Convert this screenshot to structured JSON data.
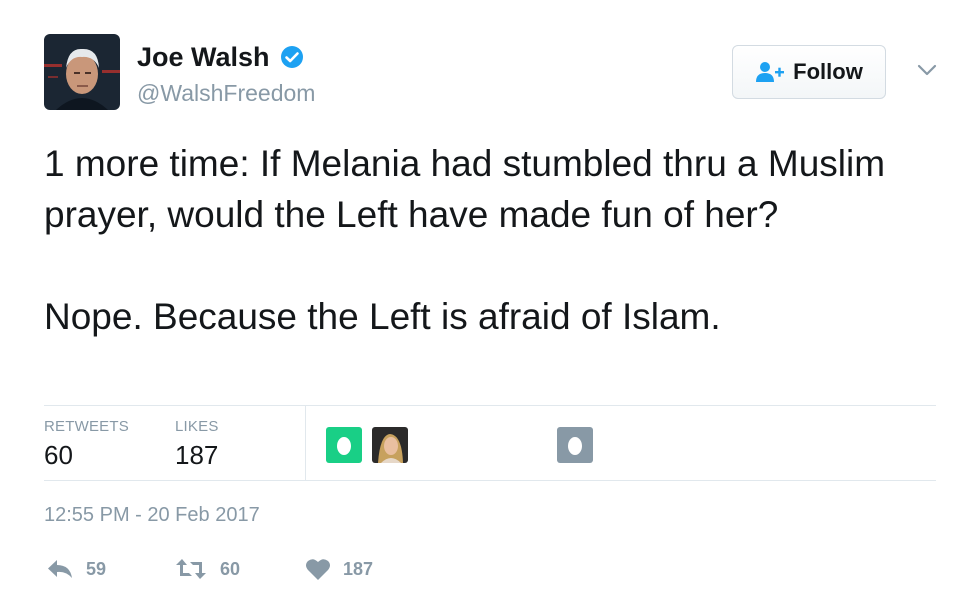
{
  "author": {
    "name": "Joe Walsh",
    "handle": "@WalshFreedom",
    "verified": true
  },
  "follow": {
    "label": "Follow",
    "icon": "add-user-icon"
  },
  "tweet": {
    "paragraphs": [
      "1 more time: If Melania had stumbled thru a Muslim prayer, would the Left have made fun of her?",
      "Nope. Because the Left is afraid of Islam."
    ]
  },
  "stats": {
    "retweets_label": "RETWEETS",
    "retweets": "60",
    "likes_label": "LIKES",
    "likes": "187"
  },
  "timestamp": "12:55 PM - 20 Feb 2017",
  "actions": {
    "reply_count": "59",
    "retweet_count": "60",
    "like_count": "187"
  },
  "colors": {
    "verified": "#1da1f2",
    "muted": "#8899a6",
    "egg_green": "#19cf86",
    "egg_gray": "#8899a6"
  }
}
